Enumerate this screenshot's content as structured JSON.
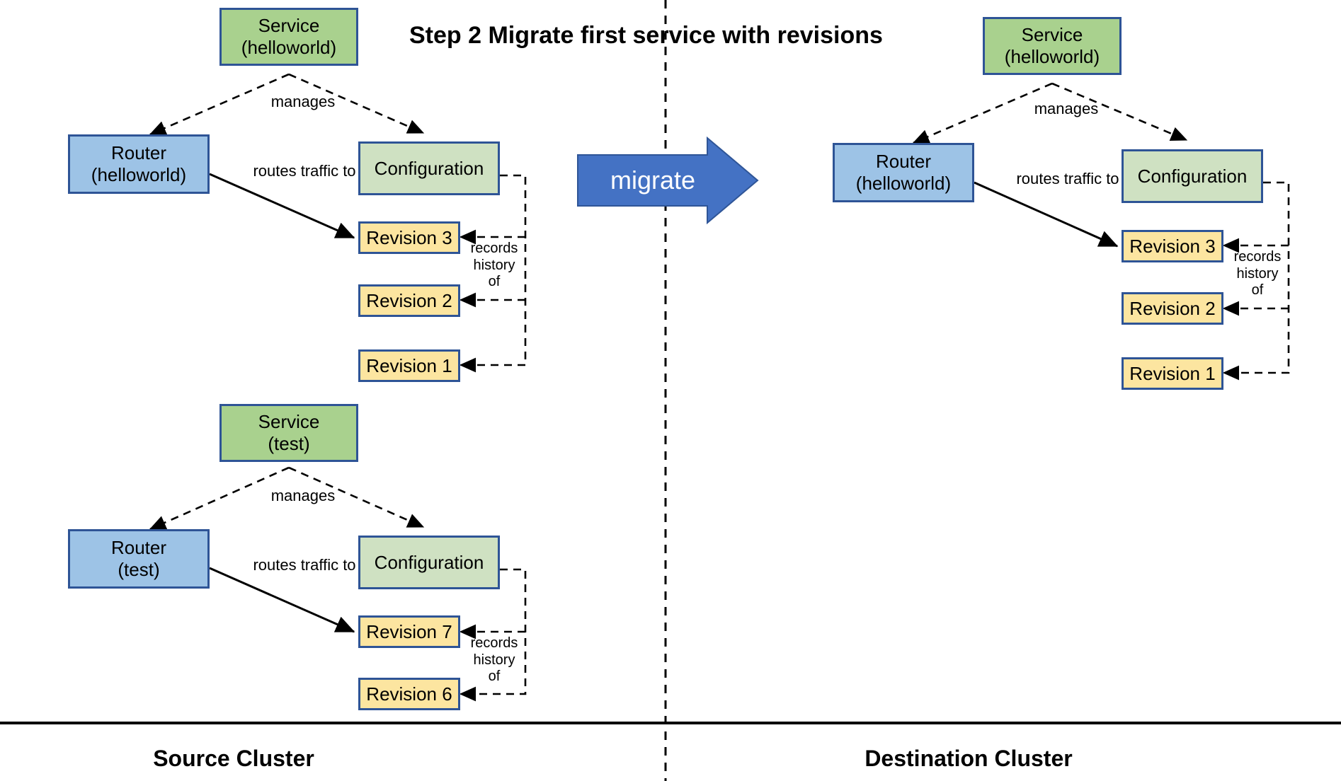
{
  "title": "Step 2 Migrate first service with revisions",
  "migrate_arrow": {
    "label": "migrate",
    "color": "#4472c4",
    "text_color": "#ffffff"
  },
  "colors": {
    "service_fill": "#a9d18e",
    "configuration_fill": "#cfe1c2",
    "router_fill": "#9dc3e6",
    "revision_fill": "#fce5a0",
    "node_border": "#2e5496",
    "divider": "#000000"
  },
  "clusters": [
    {
      "name": "source",
      "label": "Source Cluster",
      "groups": [
        {
          "name": "helloworld",
          "service": "Service\n(helloworld)",
          "router": "Router\n(helloworld)",
          "configuration": "Configuration",
          "revisions": [
            "Revision 3",
            "Revision 2",
            "Revision 1"
          ],
          "edges": {
            "manages": "manages",
            "routes": "routes traffic to",
            "records": "records\nhistory\nof"
          }
        },
        {
          "name": "test",
          "service": "Service\n(test)",
          "router": "Router\n(test)",
          "configuration": "Configuration",
          "revisions": [
            "Revision 7",
            "Revision 6"
          ],
          "edges": {
            "manages": "manages",
            "routes": "routes traffic to",
            "records": "records\nhistory\nof"
          }
        }
      ]
    },
    {
      "name": "destination",
      "label": "Destination Cluster",
      "groups": [
        {
          "name": "helloworld",
          "service": "Service\n(helloworld)",
          "router": "Router\n(helloworld)",
          "configuration": "Configuration",
          "revisions": [
            "Revision 3",
            "Revision 2",
            "Revision 1"
          ],
          "edges": {
            "manages": "manages",
            "routes": "routes traffic to",
            "records": "records\nhistory\nof"
          }
        }
      ]
    }
  ]
}
